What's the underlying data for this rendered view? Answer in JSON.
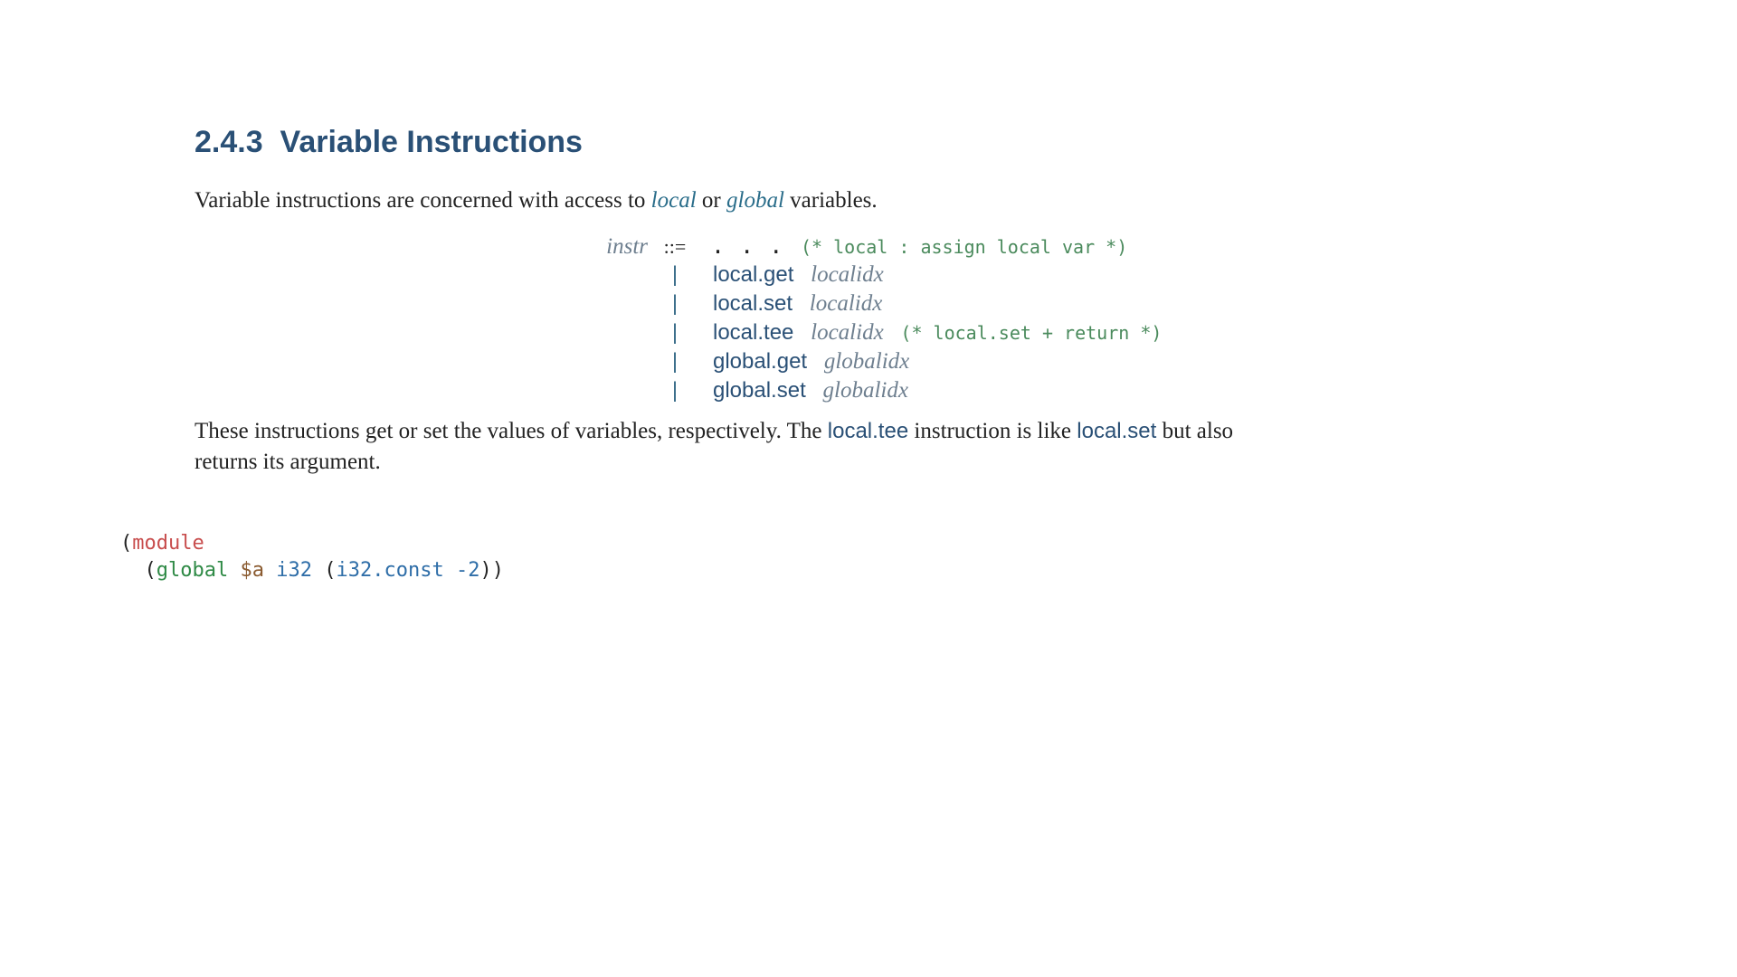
{
  "heading": {
    "number": "2.4.3",
    "title": "Variable Instructions"
  },
  "intro": {
    "pre": "Variable instructions are concerned with access to ",
    "local": "local",
    "mid": " or ",
    "global": "global",
    "post": " variables."
  },
  "grammar": {
    "lhs": "instr",
    "def_op": "::=",
    "dots": ". . .",
    "comment_top": "(* local : assign local var *)",
    "bar": "|",
    "rows": [
      {
        "kw": "local.get",
        "arg": "localidx",
        "comment": ""
      },
      {
        "kw": "local.set",
        "arg": "localidx",
        "comment": ""
      },
      {
        "kw": "local.tee",
        "arg": "localidx",
        "comment": "(* local.set + return *)"
      },
      {
        "kw": "global.get",
        "arg": "globalidx",
        "comment": ""
      },
      {
        "kw": "global.set",
        "arg": "globalidx",
        "comment": ""
      }
    ]
  },
  "para2": {
    "t1": "These instructions get or set the values of variables, respectively. The ",
    "c1": "local.tee",
    "t2": " instruction is like ",
    "c2": "local.set",
    "t3": " but also returns its argument."
  },
  "code": {
    "line1": {
      "lp": "(",
      "kw": "module"
    },
    "line2": {
      "indent": "  ",
      "lp": "(",
      "kw": "global",
      "sp1": " ",
      "name": "$a",
      "sp2": " ",
      "type": "i32",
      "sp3": " ",
      "lp2": "(",
      "fn": "i32.const",
      "sp4": " ",
      "num": "-2",
      "rp2": ")",
      "rp": ")"
    }
  }
}
